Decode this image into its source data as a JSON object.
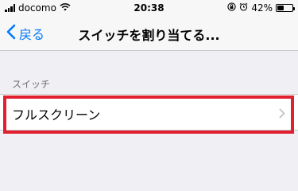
{
  "status_bar": {
    "carrier": "docomo",
    "time": "20:38",
    "battery_percent": "42%",
    "battery_level": 0.42,
    "signal_icon": "signal-bars-icon",
    "wifi_icon": "wifi-icon",
    "lock_icon": "orientation-lock-icon",
    "alarm_icon": "alarm-icon"
  },
  "nav": {
    "back_label": "戻る",
    "title": "スイッチを割り当てる..."
  },
  "section": {
    "header": "スイッチ",
    "items": [
      {
        "label": "フルスクリーン",
        "icon": "chevron-right-icon"
      }
    ]
  },
  "colors": {
    "accent": "#007aff",
    "highlight": "#e0202e",
    "background": "#efeff4"
  }
}
